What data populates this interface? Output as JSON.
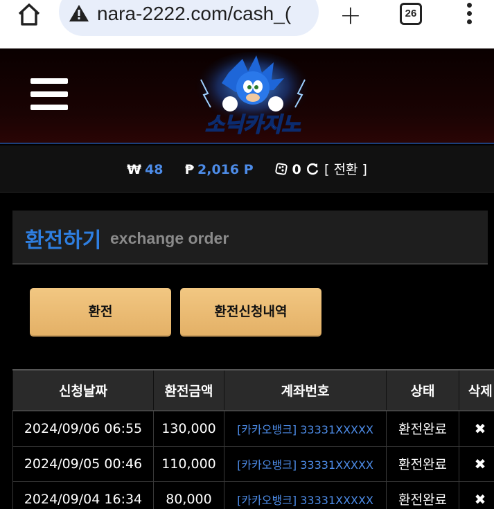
{
  "browser": {
    "url": "nara-2222.com/cash_(",
    "tab_count": "26"
  },
  "site": {
    "logo_text": "소닉카지노"
  },
  "balance": {
    "won_symbol": "₩",
    "won_value": "48",
    "point_symbol": "₱",
    "point_value": "2,016 P",
    "chip_value": "0",
    "switch_label": "[ 전환 ]"
  },
  "section": {
    "title_ko": "환전하기",
    "title_en": "exchange order"
  },
  "buttons": {
    "exchange": "환전",
    "history": "환전신청내역"
  },
  "table": {
    "headers": [
      "신청날짜",
      "환전금액",
      "계좌번호",
      "상태",
      "삭제"
    ],
    "rows": [
      {
        "date": "2024/09/06 06:55",
        "amount": "130,000",
        "account": "[카카오뱅크] 33331XXXXX",
        "status": "환전완료",
        "delete": "✖"
      },
      {
        "date": "2024/09/05 00:46",
        "amount": "110,000",
        "account": "[카카오뱅크] 33331XXXXX",
        "status": "환전완료",
        "delete": "✖"
      },
      {
        "date": "2024/09/04 16:34",
        "amount": "80,000",
        "account": "[카카오뱅크] 33331XXXXX",
        "status": "환전완료",
        "delete": "✖"
      }
    ]
  },
  "colors": {
    "accent_blue": "#2e7ee0",
    "button_gold": "#e9b970",
    "background": "#000000"
  }
}
